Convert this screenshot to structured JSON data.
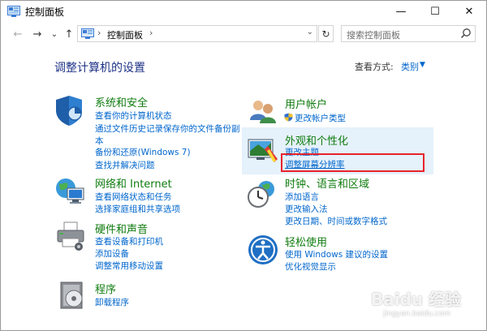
{
  "window": {
    "title": "控制面板",
    "minimize": "—",
    "maximize": "☐",
    "close": "✕"
  },
  "nav": {
    "back": "←",
    "forward": "→",
    "dropdown": "⌄",
    "up": "↑",
    "address_sep": "›",
    "address_text": "控制面板",
    "address_sep2": "›",
    "address_dropdown": "⌄",
    "refresh": "↻",
    "search_placeholder": "搜索控制面板"
  },
  "header": {
    "heading": "调整计算机的设置",
    "view_label": "查看方式:",
    "view_value": "类别",
    "view_arrow": "▼"
  },
  "categories": {
    "system": {
      "title": "系统和安全",
      "links": [
        "查看你的计算机状态",
        "通过文件历史记录保存你的文件备份副",
        "本",
        "备份和还原(Windows 7)",
        "查找并解决问题"
      ]
    },
    "network": {
      "title": "网络和 Internet",
      "links": [
        "查看网络状态和任务",
        "选择家庭组和共享选项"
      ]
    },
    "hardware": {
      "title": "硬件和声音",
      "links": [
        "查看设备和打印机",
        "添加设备",
        "调整常用移动设置"
      ]
    },
    "programs": {
      "title": "程序",
      "links": [
        "卸载程序"
      ]
    },
    "user": {
      "title": "用户帐户",
      "links": [
        "更改帐户类型"
      ]
    },
    "appearance": {
      "title": "外观和个性化",
      "links": [
        "更改主题",
        "调整屏幕分辨率"
      ]
    },
    "clock": {
      "title": "时钟、语言和区域",
      "links": [
        "添加语言",
        "更改输入法",
        "更改日期、时间或数字格式"
      ]
    },
    "ease": {
      "title": "轻松使用",
      "links": [
        "使用 Windows 建议的设置",
        "优化视觉显示"
      ]
    }
  },
  "watermark": {
    "text": "Baidu 经验",
    "sub": "jingyan.baidu.com"
  },
  "colors": {
    "link": "#0066cc",
    "category_title": "#107c10",
    "heading": "#1e3287",
    "highlight": "#e5f1fb",
    "annotation": "#e8222b"
  }
}
